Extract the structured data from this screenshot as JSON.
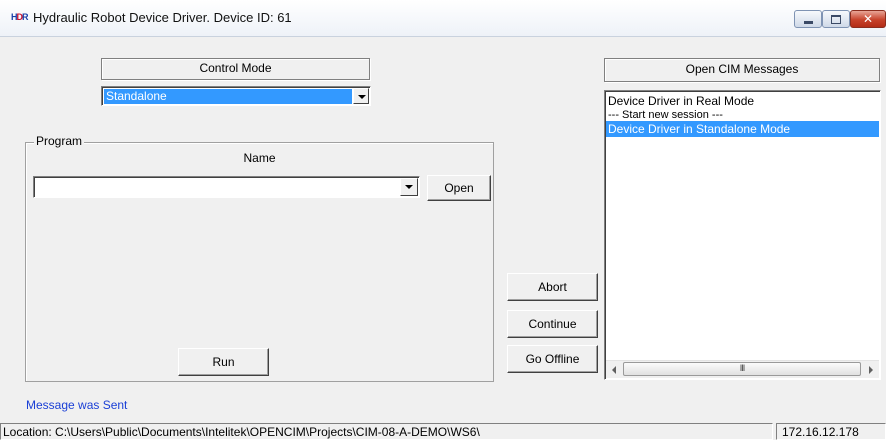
{
  "window": {
    "icon_text": "HDR",
    "title": "Hydraulic Robot Device Driver. Device ID: 61",
    "close_glyph": "✕"
  },
  "control_mode": {
    "header": "Control Mode",
    "selected": "Standalone"
  },
  "program": {
    "group_label": "Program",
    "name_label": "Name",
    "selected": "",
    "open_label": "Open",
    "run_label": "Run"
  },
  "actions": {
    "abort_label": "Abort",
    "continue_label": "Continue",
    "go_offline_label": "Go Offline"
  },
  "messages": {
    "header": "Open CIM Messages",
    "items": [
      "Device Driver in Real Mode",
      "--- Start new session ---",
      "Device Driver in Standalone Mode"
    ],
    "selected_index": 2,
    "scroll_thumb_glyph": "III"
  },
  "status": {
    "message": "Message was Sent",
    "location": "Location: C:\\Users\\Public\\Documents\\Intelitek\\OPENCIM\\Projects\\CIM-08-A-DEMO\\WS6\\",
    "ip": "172.16.12.178"
  },
  "colors": {
    "selection": "#3399ff",
    "status_message": "#1a3fd6",
    "background": "#f0f0f0"
  }
}
